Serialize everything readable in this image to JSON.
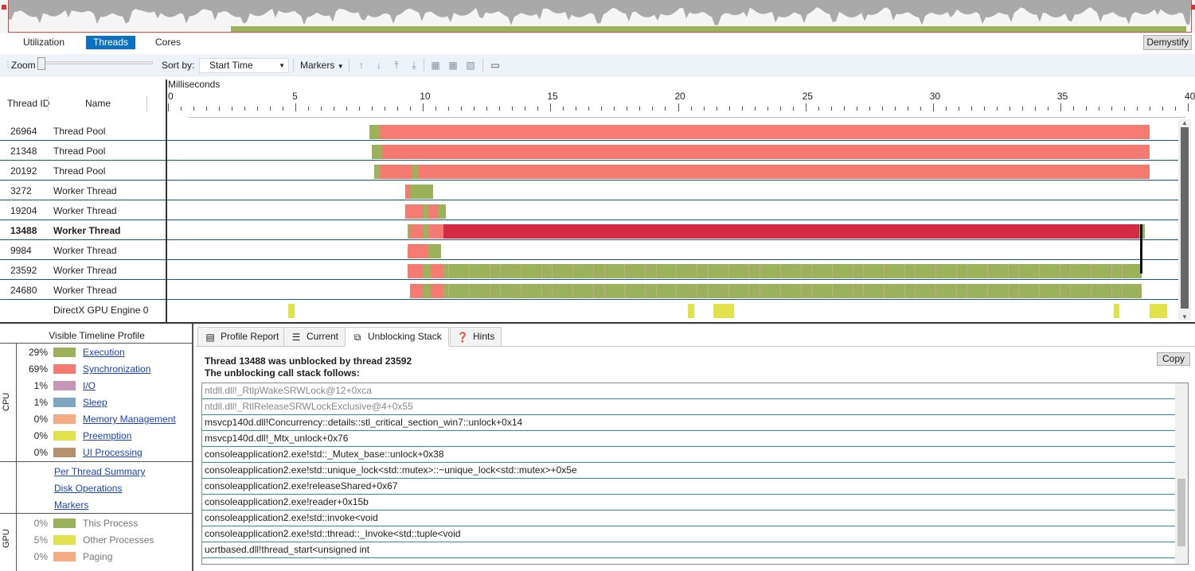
{
  "view_tabs": [
    {
      "label": "Utilization",
      "active": false
    },
    {
      "label": "Threads",
      "active": true
    },
    {
      "label": "Cores",
      "active": false
    }
  ],
  "demystify_label": "Demystify",
  "toolbar": {
    "zoom_label": "Zoom",
    "zoom_level": 0,
    "sort_label": "Sort by:",
    "sort_value": "Start Time",
    "markers_label": "Markers",
    "icons": [
      "move-up-icon",
      "move-down-icon",
      "move-top-icon",
      "move-bottom-icon",
      "hide-threads-icon",
      "show-threads-icon",
      "remove-threads-icon",
      "export-icon"
    ]
  },
  "timeline": {
    "unit_label": "Milliseconds",
    "col_thread_id": "Thread ID",
    "col_name": "Name",
    "axis_range": [
      0,
      40
    ],
    "ticks": [
      "0",
      "5",
      "10",
      "15",
      "20",
      "25",
      "30",
      "35",
      "40"
    ],
    "colors": {
      "execution": "#9bb25a",
      "synchronization": "#f47a72",
      "selected_sync": "#d42b45",
      "preemption": "#dfe24a",
      "io": "#c896b8"
    },
    "rows": [
      {
        "id": "26964",
        "name": "Thread Pool",
        "bold": false,
        "segments": [
          [
            7.9,
            8.3,
            "execution"
          ],
          [
            8.3,
            8.4,
            "synchronization"
          ],
          [
            8.4,
            38.5,
            "synchronization"
          ]
        ]
      },
      {
        "id": "21348",
        "name": "Thread Pool",
        "bold": false,
        "segments": [
          [
            8.0,
            8.4,
            "execution"
          ],
          [
            8.4,
            38.5,
            "synchronization"
          ]
        ]
      },
      {
        "id": "20192",
        "name": "Thread Pool",
        "bold": false,
        "segments": [
          [
            8.1,
            8.3,
            "execution"
          ],
          [
            8.3,
            9.6,
            "synchronization"
          ],
          [
            9.6,
            9.8,
            "execution"
          ],
          [
            9.8,
            38.5,
            "synchronization"
          ]
        ]
      },
      {
        "id": "3272",
        "name": "Worker Thread",
        "bold": false,
        "segments": [
          [
            9.3,
            9.5,
            "synchronization"
          ],
          [
            9.5,
            10.4,
            "execution"
          ]
        ]
      },
      {
        "id": "19204",
        "name": "Worker Thread",
        "bold": false,
        "segments": [
          [
            9.3,
            10.0,
            "synchronization"
          ],
          [
            10.0,
            10.2,
            "execution"
          ],
          [
            10.2,
            10.6,
            "synchronization"
          ],
          [
            10.6,
            10.9,
            "execution"
          ]
        ]
      },
      {
        "id": "13488",
        "name": "Worker Thread",
        "bold": true,
        "segments": [
          [
            9.4,
            9.5,
            "execution"
          ],
          [
            9.5,
            10.0,
            "synchronization"
          ],
          [
            10.0,
            10.2,
            "execution"
          ],
          [
            10.2,
            10.8,
            "synchronization"
          ],
          [
            10.8,
            38.1,
            "selected_sync"
          ],
          [
            38.1,
            38.3,
            "execution"
          ]
        ]
      },
      {
        "id": "9984",
        "name": "Worker Thread",
        "bold": false,
        "segments": [
          [
            9.4,
            10.2,
            "synchronization"
          ],
          [
            10.2,
            10.7,
            "execution"
          ]
        ]
      },
      {
        "id": "23592",
        "name": "Worker Thread",
        "bold": false,
        "segments": [
          [
            9.4,
            10.0,
            "synchronization"
          ],
          [
            10.0,
            10.3,
            "execution"
          ],
          [
            10.3,
            10.8,
            "synchronization"
          ],
          [
            10.8,
            38.2,
            "execution"
          ]
        ]
      },
      {
        "id": "24680",
        "name": "Worker Thread",
        "bold": false,
        "segments": [
          [
            9.5,
            10.0,
            "synchronization"
          ],
          [
            10.0,
            10.3,
            "execution"
          ],
          [
            10.3,
            10.8,
            "synchronization"
          ],
          [
            10.8,
            38.2,
            "execution"
          ]
        ]
      },
      {
        "id": "",
        "name": "DirectX GPU Engine 0",
        "bold": false,
        "segments": [
          [
            4.7,
            4.95,
            "preemption"
          ],
          [
            20.4,
            20.65,
            "preemption"
          ],
          [
            21.4,
            22.2,
            "preemption"
          ],
          [
            37.1,
            37.3,
            "preemption"
          ],
          [
            38.5,
            39.2,
            "preemption"
          ]
        ]
      }
    ]
  },
  "legend": {
    "title": "Visible Timeline Profile",
    "cpu_label": "CPU",
    "gpu_label": "GPU",
    "cpu_items": [
      {
        "pct": "29%",
        "label": "Execution",
        "color": "#9bb25a"
      },
      {
        "pct": "69%",
        "label": "Synchronization",
        "color": "#f47a72"
      },
      {
        "pct": "1%",
        "label": "I/O",
        "color": "#c896b8"
      },
      {
        "pct": "1%",
        "label": "Sleep",
        "color": "#7ea6c0"
      },
      {
        "pct": "0%",
        "label": "Memory Management",
        "color": "#f6ac82"
      },
      {
        "pct": "0%",
        "label": "Preemption",
        "color": "#dfe24a"
      },
      {
        "pct": "0%",
        "label": "UI Processing",
        "color": "#b7906e"
      }
    ],
    "links": [
      "Per Thread Summary",
      "Disk Operations",
      "Markers"
    ],
    "gpu_items": [
      {
        "pct": "0%",
        "label": "This Process",
        "color": "#9bb25a"
      },
      {
        "pct": "5%",
        "label": "Other Processes",
        "color": "#dfe24a"
      },
      {
        "pct": "0%",
        "label": "Paging",
        "color": "#f6ac82"
      }
    ]
  },
  "detail_tabs": [
    {
      "label": "Profile Report",
      "icon": "report-icon",
      "active": false
    },
    {
      "label": "Current",
      "icon": "current-icon",
      "active": false
    },
    {
      "label": "Unblocking Stack",
      "icon": "stack-icon",
      "active": true
    },
    {
      "label": "Hints",
      "icon": "help-icon",
      "active": false
    }
  ],
  "unblocking": {
    "heading1": "Thread 13488 was unblocked by thread 23592",
    "heading2": "The unblocking call stack follows:",
    "copy_label": "Copy",
    "frames": [
      {
        "text": "ntdll.dll!_RtlpWakeSRWLock@12+0xca",
        "dim": true
      },
      {
        "text": "ntdll.dll!_RtlReleaseSRWLockExclusive@4+0x55",
        "dim": true
      },
      {
        "text": "msvcp140d.dll!Concurrency::details::stl_critical_section_win7::unlock+0x14",
        "dim": false
      },
      {
        "text": "msvcp140d.dll!_Mtx_unlock+0x76",
        "dim": false
      },
      {
        "text": "consoleapplication2.exe!std::_Mutex_base::unlock+0x38",
        "dim": false
      },
      {
        "text": "consoleapplication2.exe!std::unique_lock<std::mutex>::~unique_lock<std::mutex>+0x5e",
        "dim": false
      },
      {
        "text": "consoleapplication2.exe!releaseShared+0x67",
        "dim": false
      },
      {
        "text": "consoleapplication2.exe!reader+0x15b",
        "dim": false
      },
      {
        "text": "consoleapplication2.exe!std::invoke<void",
        "dim": false
      },
      {
        "text": "consoleapplication2.exe!std::thread::_Invoke<std::tuple<void",
        "dim": false
      },
      {
        "text": "ucrtbased.dll!thread_start<unsigned int",
        "dim": false
      }
    ]
  }
}
